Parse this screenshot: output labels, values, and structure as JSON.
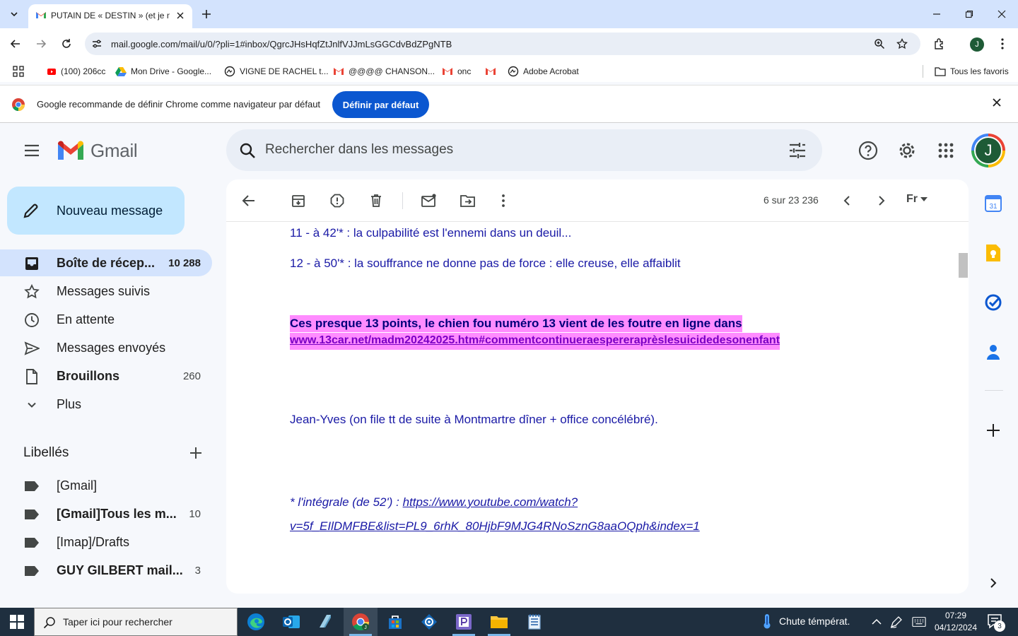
{
  "browser": {
    "tab_title": "PUTAIN DE « DESTIN » (et je n'é",
    "url": "mail.google.com/mail/u/0/?pli=1#inbox/QgrcJHsHqfZtJnlfVJJmLsGGCdvBdZPgNTB",
    "profile_initial": "J",
    "bookmarks": [
      {
        "label": "(100) 206cc",
        "icon": "youtube-icon"
      },
      {
        "label": "Mon Drive - Google...",
        "icon": "drive-icon"
      },
      {
        "label": "VIGNE DE RACHEL t...",
        "icon": "globe-icon"
      },
      {
        "label": "@@@@ CHANSON...",
        "icon": "gmail-icon"
      },
      {
        "label": "onc",
        "icon": "gmail-icon"
      },
      {
        "label": "",
        "icon": "gmail-icon"
      },
      {
        "label": "Adobe Acrobat",
        "icon": "globe-icon"
      }
    ],
    "all_bookmarks": "Tous les favoris"
  },
  "infobar": {
    "text": "Google recommande de définir Chrome comme navigateur par défaut",
    "button": "Définir par défaut"
  },
  "gmail": {
    "logo_text": "Gmail",
    "search_placeholder": "Rechercher dans les messages",
    "avatar_initial": "J",
    "compose_label": "Nouveau message",
    "nav": [
      {
        "label": "Boîte de récep...",
        "count": "10 288",
        "icon": "inbox-icon"
      },
      {
        "label": "Messages suivis",
        "count": "",
        "icon": "star-icon"
      },
      {
        "label": "En attente",
        "count": "",
        "icon": "clock-icon"
      },
      {
        "label": "Messages envoyés",
        "count": "",
        "icon": "send-icon"
      },
      {
        "label": "Brouillons",
        "count": "260",
        "icon": "draft-icon"
      },
      {
        "label": "Plus",
        "count": "",
        "icon": "chevron-down-icon"
      }
    ],
    "labels_heading": "Libellés",
    "labels": [
      {
        "label": "[Gmail]",
        "count": ""
      },
      {
        "label": "[Gmail]Tous les m...",
        "count": "10"
      },
      {
        "label": "[Imap]/Drafts",
        "count": ""
      },
      {
        "label": "GUY GILBERT mail...",
        "count": "3"
      }
    ],
    "pager": "6 sur 23 236",
    "input_tool": "Fr"
  },
  "message": {
    "line11": "11 - à 42'* : la culpabilité est l'ennemi dans un deuil...",
    "line12": "12 - à 50'* : la souffrance ne donne pas de force : elle creuse, elle affaiblit",
    "highlight_line": "Ces presque 13 points, le chien fou numéro 13 vient de les foutre en ligne dans",
    "highlight_link": "www.13car.net/madm20242025.htm#commentcontinueraespereraprèslesuicidedesonenfant",
    "signature": "Jean-Yves (on file tt de suite à Montmartre dîner + office concélébré).",
    "footnote_prefix": "* l'intégrale (de 52')  : ",
    "footnote_link": "https://www.youtube.com/watch?v=5f_EIlDMFBE&list=PL9_6rhK_80HjbF9MJG4RNoSznG8aaOQph&index=1",
    "colors": {
      "text": "#1a1aa6",
      "highlight": "#ff8cff"
    }
  },
  "taskbar": {
    "search_placeholder": "Taper ici pour rechercher",
    "weather": "Chute témpérat.",
    "time": "07:29",
    "date": "04/12/2024",
    "notifications": "3"
  }
}
